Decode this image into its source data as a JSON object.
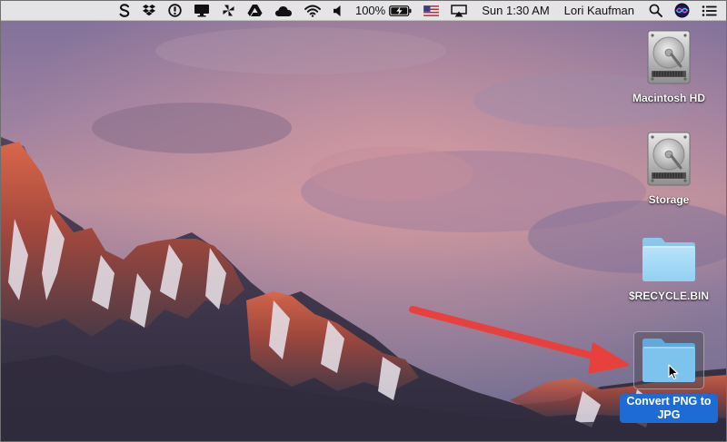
{
  "menubar": {
    "icons": [
      {
        "name": "sync-s-icon",
        "label": "S"
      },
      {
        "name": "dropbox-icon"
      },
      {
        "name": "info-circle-icon"
      },
      {
        "name": "display-icon"
      },
      {
        "name": "pinwheel-icon"
      },
      {
        "name": "google-drive-icon"
      },
      {
        "name": "cloud-icon"
      },
      {
        "name": "wifi-icon"
      },
      {
        "name": "volume-icon"
      }
    ],
    "battery_percent": "100%",
    "battery_level": 1.0,
    "input_flag": "us-flag-icon",
    "clock": "Sun 1:30 AM",
    "user_name": "Lori Kaufman"
  },
  "desktop": {
    "icons": [
      {
        "label": "Macintosh HD",
        "type": "hard-drive"
      },
      {
        "label": "Storage",
        "type": "hard-drive"
      },
      {
        "label": "$RECYCLE.BIN",
        "type": "folder"
      },
      {
        "label": "Convert PNG to JPG",
        "type": "folder",
        "selected": true
      }
    ]
  },
  "colors": {
    "annotation_arrow": "#e8413d",
    "selection_blue": "#1f6bd6",
    "folder_blue": "#8fd0f3"
  }
}
